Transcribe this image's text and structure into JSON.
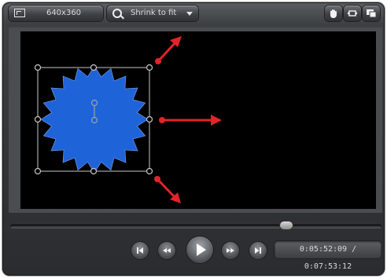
{
  "toolbar": {
    "dimensions_label": "640x360",
    "zoom_label": "Shrink to fit",
    "dimensions_icon": "resize-icon",
    "zoom_icon": "magnifier-icon",
    "right_icons": [
      "hand-pan-icon",
      "fit-to-window-icon",
      "window-mode-icon"
    ]
  },
  "canvas": {
    "background": "#000000",
    "shape": {
      "kind": "starburst",
      "fill": "#1f63d8",
      "selected": true
    },
    "annotation_color": "#e0242a"
  },
  "transport": {
    "time_current": "0:05:52:09",
    "time_total": "0:07:53:12",
    "time_separator": " / ",
    "time_text": "0:05:52:09 / 0:07:53:12",
    "progress_fraction": 0.745,
    "buttons": [
      "skip-to-start-icon",
      "rewind-icon",
      "play-icon",
      "fast-forward-icon",
      "skip-to-end-icon"
    ]
  },
  "colors": {
    "chrome_dark": "#2a2c2f",
    "chrome_light": "#5b5e62",
    "text": "#dcdcdc"
  }
}
